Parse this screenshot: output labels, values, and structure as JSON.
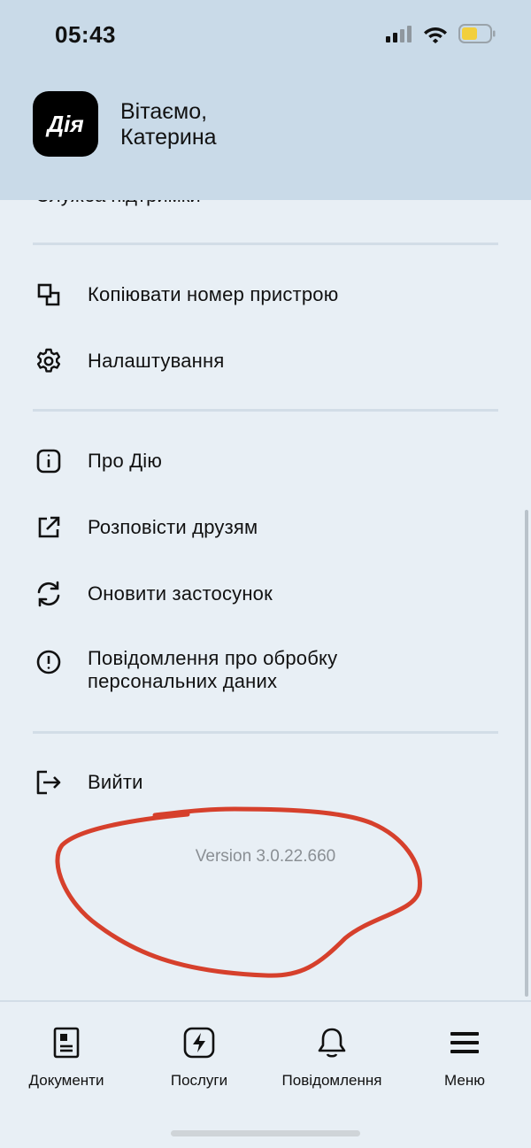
{
  "status_bar": {
    "time": "05:43"
  },
  "header": {
    "logo_text": "Дія",
    "greeting_line1": "Вітаємо,",
    "greeting_line2": "Катерина"
  },
  "menu": {
    "cut_item": "Служба підтримки",
    "items": [
      {
        "label": "Копіювати номер пристрою",
        "icon": "copy-icon"
      },
      {
        "label": "Налаштування",
        "icon": "gear-icon"
      },
      {
        "label": "Про Дію",
        "icon": "info-icon"
      },
      {
        "label": "Розповісти друзям",
        "icon": "share-icon"
      },
      {
        "label": "Оновити застосунок",
        "icon": "refresh-icon"
      },
      {
        "label": "Повідомлення про обробку",
        "label2": "персональних даних",
        "icon": "exclamation-icon"
      },
      {
        "label": "Вийти",
        "icon": "logout-icon"
      }
    ]
  },
  "version": "Version 3.0.22.660",
  "annotation_color": "#d6402c",
  "tabs": [
    {
      "label": "Документи",
      "icon": "document-icon"
    },
    {
      "label": "Послуги",
      "icon": "lightning-icon"
    },
    {
      "label": "Повідомлення",
      "icon": "bell-icon"
    },
    {
      "label": "Меню",
      "icon": "menu-icon"
    }
  ]
}
